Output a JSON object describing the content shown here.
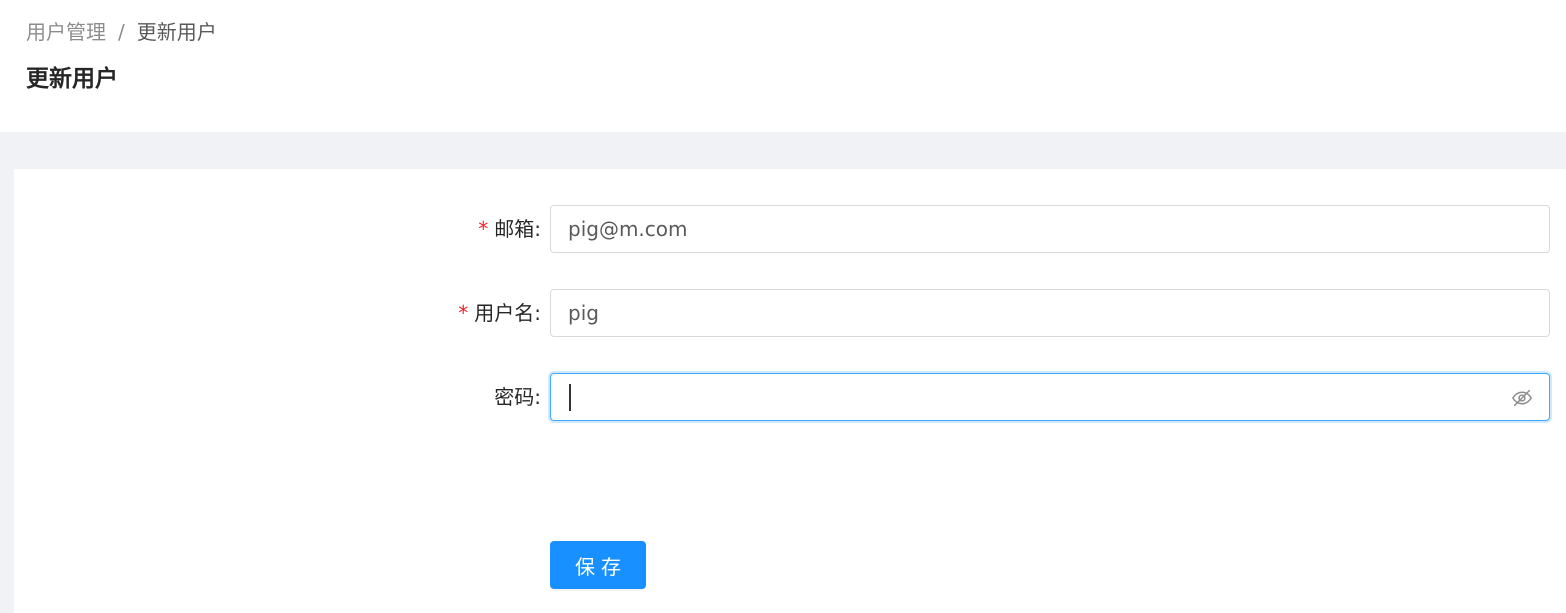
{
  "breadcrumb": {
    "parent": "用户管理",
    "separator": "/",
    "current": "更新用户"
  },
  "page": {
    "title": "更新用户"
  },
  "form": {
    "email": {
      "label": "邮箱",
      "required": true,
      "value": "pig@m.com"
    },
    "username": {
      "label": "用户名",
      "required": true,
      "value": "pig"
    },
    "password": {
      "label": "密码",
      "required": false,
      "value": "",
      "toggle_icon": "eye-invisible-icon"
    },
    "label_suffix": ":",
    "required_mark": "*",
    "save_label": "保存"
  },
  "colors": {
    "primary": "#1890ff",
    "required": "#f5222d",
    "page_bg": "#f0f2f5",
    "focus_border": "#40a9ff"
  }
}
